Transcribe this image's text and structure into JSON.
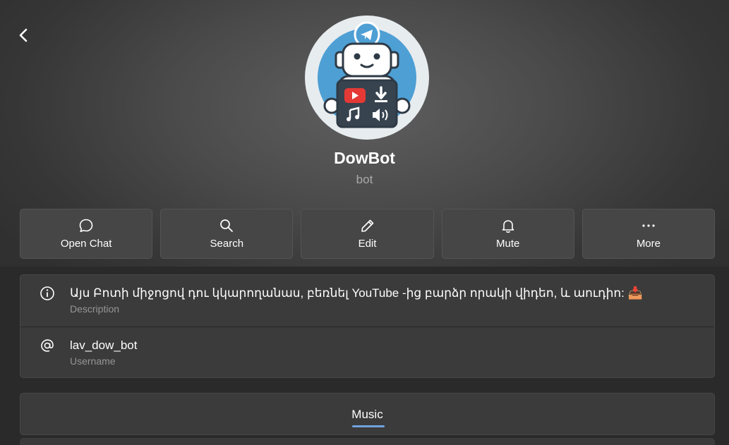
{
  "profile": {
    "name": "DowBot",
    "subtitle": "bot",
    "avatar_icon": "robot-bot-avatar-icon"
  },
  "actions": [
    {
      "label": "Open Chat",
      "icon": "chat-bubble-icon"
    },
    {
      "label": "Search",
      "icon": "search-icon"
    },
    {
      "label": "Edit",
      "icon": "pencil-icon"
    },
    {
      "label": "Mute",
      "icon": "bell-icon"
    },
    {
      "label": "More",
      "icon": "more-dots-icon"
    }
  ],
  "info": {
    "description": "Այս Բոտի միջոցով դու կկարողանաս, բեռնել YouTube -ից բարձր որակի վիդեո, և աուդիո: 📥",
    "description_caption": "Description",
    "username": "lav_dow_bot",
    "username_caption": "Username"
  },
  "tabs": {
    "active": "Music"
  },
  "colors": {
    "accent": "#6fa3df",
    "card": "#3b3b3b",
    "button": "#464646"
  }
}
